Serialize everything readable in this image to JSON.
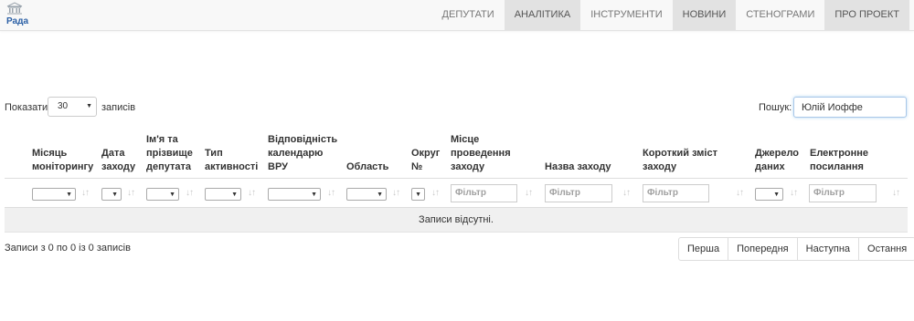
{
  "brand": {
    "text": "Рада",
    "icon": "building-icon"
  },
  "nav": {
    "items": [
      "Депутати",
      "Аналітика",
      "Інструменти",
      "Новини",
      "Стенограми",
      "Про проект"
    ],
    "shaded": [
      false,
      true,
      false,
      true,
      false,
      true
    ]
  },
  "length": {
    "label": "Показати",
    "value": "30",
    "suffix": "записів"
  },
  "search": {
    "label": "Пошук:",
    "value": "Юлій Иоффе"
  },
  "table": {
    "headers": [
      "Місяць моніторингу",
      "Дата заходу",
      "Ім'я та прізвище депутата",
      "Тип активності",
      "Відповідність календарю ВРУ",
      "Область",
      "Округ №",
      "Місце проведення заходу",
      "Назва заходу",
      "Короткий зміст заходу",
      "Джерело даних",
      "Електронне посилання"
    ],
    "filter_placeholder": "Фільтр",
    "empty_message": "Записи відсутні."
  },
  "info": "Записи з 0 по 0 із 0 записів",
  "pagination": [
    "Перша",
    "Попередня",
    "Наступна",
    "Остання"
  ]
}
